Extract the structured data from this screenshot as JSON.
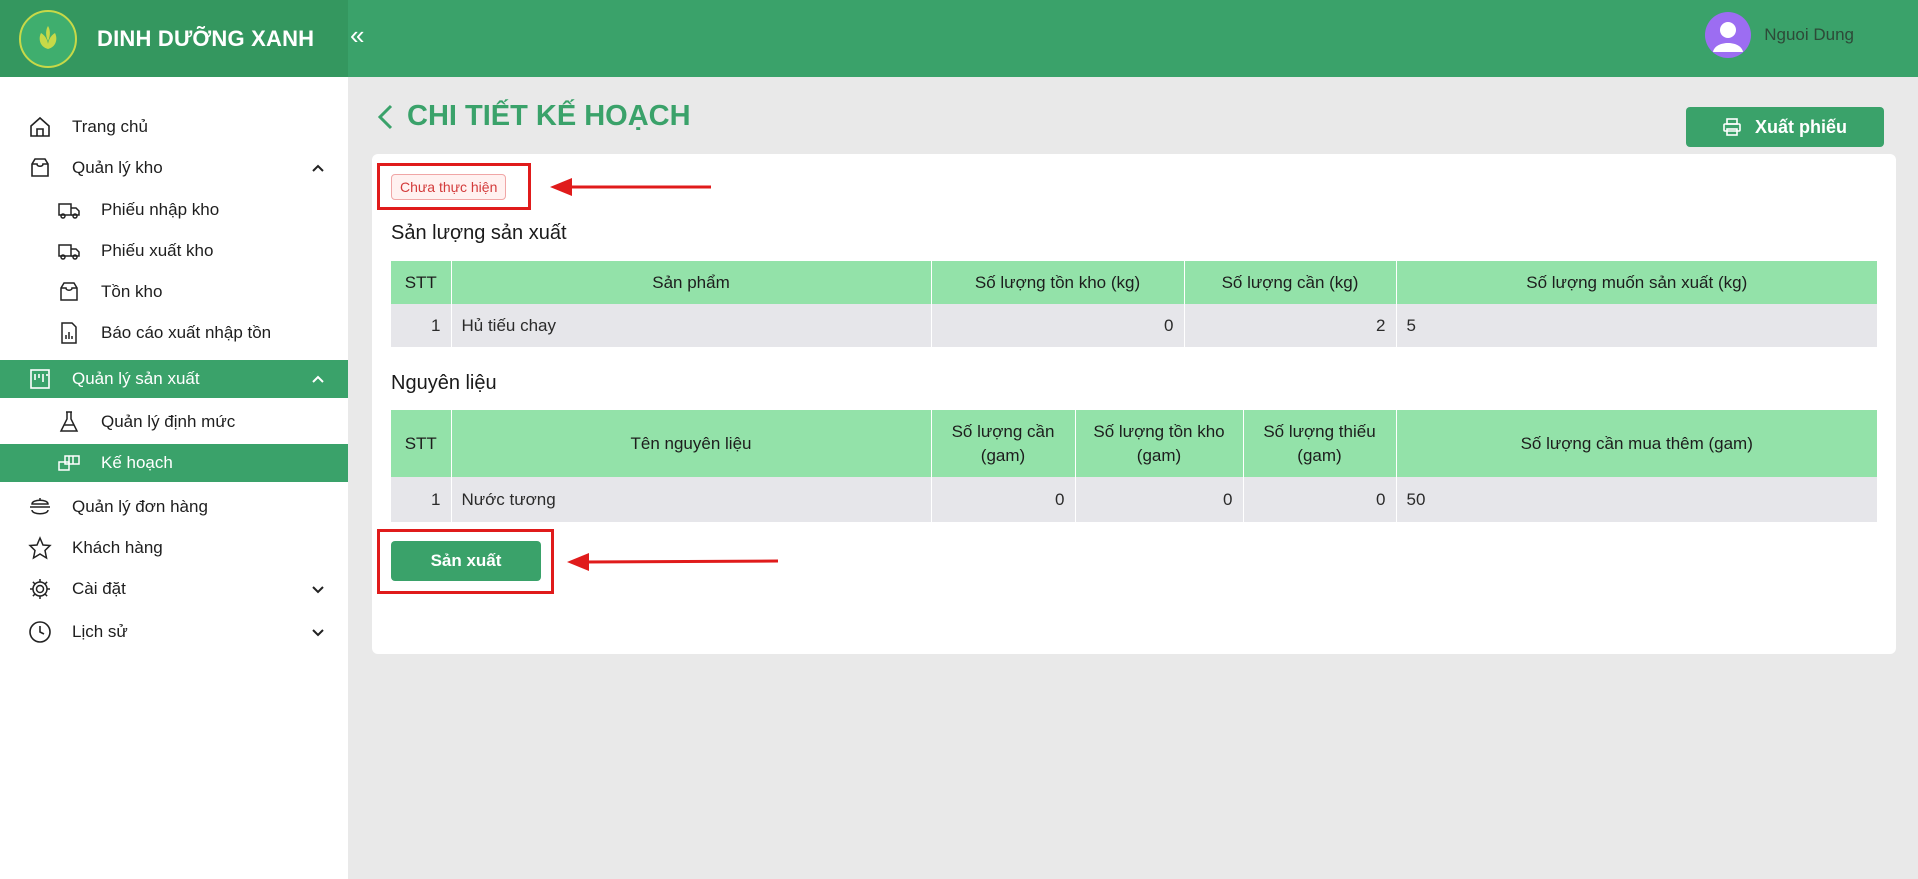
{
  "brand": {
    "name": "DINH DƯỠNG XANH",
    "collapse_icon": "double-chevron-left-icon"
  },
  "user": {
    "name": "Nguoi Dung"
  },
  "sidebar": {
    "items": [
      {
        "label": "Trang chủ",
        "icon": "home-icon"
      },
      {
        "label": "Quản lý kho",
        "icon": "inbox-icon",
        "expanded": true
      },
      {
        "label": "Phiếu nhập kho",
        "icon": "truck-in-icon"
      },
      {
        "label": "Phiếu xuất kho",
        "icon": "truck-out-icon"
      },
      {
        "label": "Tồn kho",
        "icon": "inbox-icon"
      },
      {
        "label": "Báo cáo xuất nhập tồn",
        "icon": "report-icon"
      },
      {
        "label": "Quản lý sản xuất",
        "icon": "factory-icon",
        "expanded": true,
        "active": true
      },
      {
        "label": "Quản lý định mức",
        "icon": "flask-icon"
      },
      {
        "label": "Kế hoạch",
        "icon": "plan-icon",
        "active": true
      },
      {
        "label": "Quản lý đơn hàng",
        "icon": "order-icon"
      },
      {
        "label": "Khách hàng",
        "icon": "star-icon"
      },
      {
        "label": "Cài đặt",
        "icon": "gear-icon",
        "expanded": false
      },
      {
        "label": "Lịch sử",
        "icon": "clock-icon",
        "expanded": false
      }
    ]
  },
  "main": {
    "title": "CHI TIẾT KẾ HOẠCH",
    "export_label": "Xuất phiếu",
    "status_badge": "Chưa thực hiện",
    "production_section": {
      "title": "Sản lượng sản xuất",
      "headers": [
        "STT",
        "Sản phẩm",
        "Số lượng tồn kho (kg)",
        "Số lượng cần (kg)",
        "Số lượng muốn sản xuất (kg)"
      ],
      "rows": [
        {
          "stt": "1",
          "product": "Hủ tiếu chay",
          "stock": "0",
          "need": "2",
          "want": "5"
        }
      ]
    },
    "materials_section": {
      "title": "Nguyên liệu",
      "headers": [
        "STT",
        "Tên nguyên liệu",
        "Số lượng cần (gam)",
        "Số lượng tồn kho (gam)",
        "Số lượng thiếu (gam)",
        "Số lượng cần mua thêm (gam)"
      ],
      "rows": [
        {
          "stt": "1",
          "name": "Nước tương",
          "need": "0",
          "stock": "0",
          "missing": "0",
          "buy": "50"
        }
      ]
    },
    "produce_label": "Sản xuất"
  },
  "colors": {
    "primary": "#3aa26a",
    "table_header": "#93e2a9",
    "annotation": "#e01b1b",
    "badge_text": "#d33b3b"
  }
}
